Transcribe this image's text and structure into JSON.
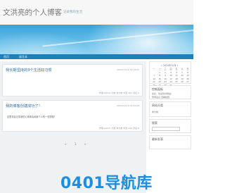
{
  "site": {
    "title": "文洪亮的个人博客",
    "description": "记录我的生活"
  },
  "nav": {
    "items": [
      {
        "label": "首页"
      },
      {
        "label": "留言本"
      }
    ]
  },
  "posts": [
    {
      "title": "我长期坚持的3个生活好习惯",
      "date": "2024-10-17 03:13:20",
      "excerpt": "",
      "meta": "作者:admin  分类:未分类  浏览:221  评论:0"
    },
    {
      "title": "我的博客创建成功了！",
      "date": "2024-10-17 03:00:06",
      "excerpt": "这里将会记录我的心得体会和我个人的一些感想！",
      "meta": "作者:admin  分类:未分类  浏览:210  评论:0"
    }
  ],
  "pager": {
    "prev": "«",
    "current": "1",
    "next": "»"
  },
  "sidebar": {
    "calendar": {
      "title": "« 2024年10月 »",
      "weekdays": [
        "一",
        "二",
        "三",
        "四",
        "五",
        "六",
        "日"
      ],
      "weeks": [
        [
          "",
          "1",
          "2",
          "3",
          "4",
          "5",
          "6"
        ],
        [
          "7",
          "8",
          "9",
          "10",
          "11",
          "12",
          "13"
        ],
        [
          "14",
          "15",
          "16",
          "17",
          "18",
          "19",
          "20"
        ],
        [
          "21",
          "22",
          "23",
          "24",
          "25",
          "26",
          "27"
        ],
        [
          "28",
          "29",
          "30",
          "31",
          "",
          "",
          ""
        ]
      ]
    },
    "control_panel": {
      "title": "控制面板",
      "line1": "您好，欢迎到访网站！",
      "line2": "登录后台  查看权限"
    },
    "categories": {
      "title": "网站分类",
      "items": [
        "未分类"
      ]
    },
    "search": {
      "title": "搜索"
    },
    "recent": {
      "title": "最新发表"
    }
  },
  "watermark": {
    "text": "0401导航库"
  },
  "colors": {
    "nav_bg": "#1f7fb8",
    "link": "#2a6fa8",
    "watermark": "#1e8fe0"
  }
}
